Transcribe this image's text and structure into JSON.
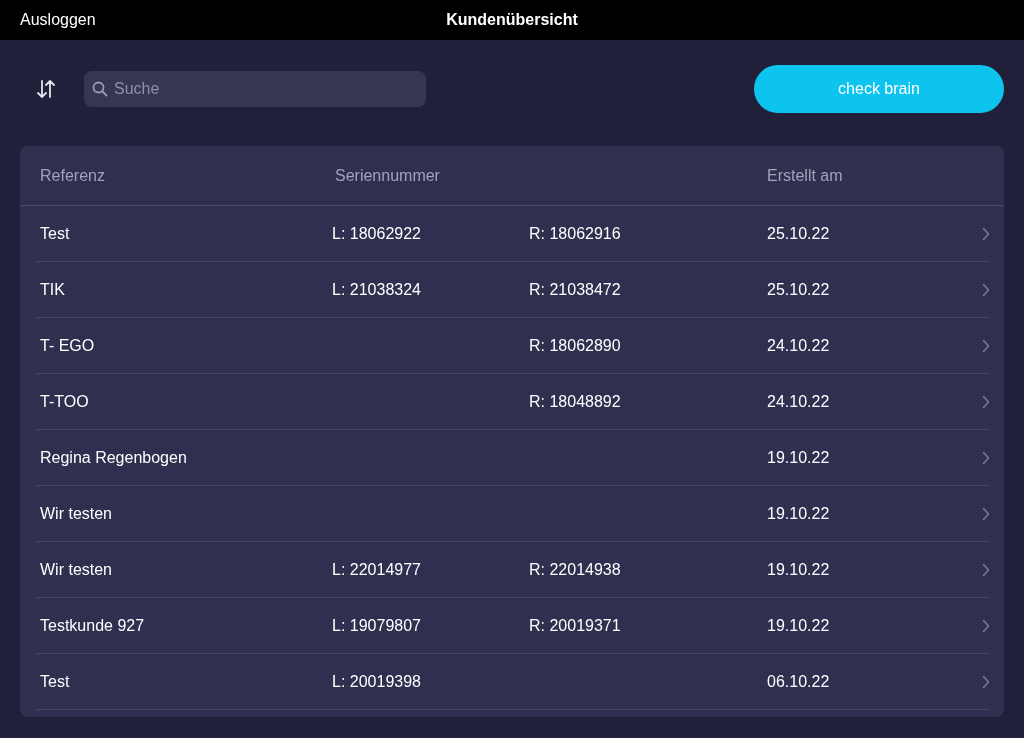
{
  "top_bar": {
    "logout": "Ausloggen",
    "title": "Kundenübersicht"
  },
  "toolbar": {
    "search": {
      "placeholder": "Suche"
    },
    "button": "check brain"
  },
  "table": {
    "columns": [
      "Referenz",
      "Seriennummer",
      "Erstellt am"
    ],
    "rows": [
      {
        "reference": "Test",
        "serial_left": "L: 18062922",
        "serial_right": "R: 18062916",
        "created": "25.10.22"
      },
      {
        "reference": "TIK",
        "serial_left": "L: 21038324",
        "serial_right": "R: 21038472",
        "created": "25.10.22"
      },
      {
        "reference": "T- EGO",
        "serial_right": "R: 18062890",
        "created": "24.10.22"
      },
      {
        "reference": "T-TOO",
        "serial_right": "R: 18048892",
        "created": "24.10.22"
      },
      {
        "reference": "Regina Regenbogen",
        "created": "19.10.22"
      },
      {
        "reference": "Wir testen",
        "created": "19.10.22"
      },
      {
        "reference": "Wir testen",
        "serial_left": "L: 22014977",
        "serial_right": "R: 22014938",
        "created": "19.10.22"
      },
      {
        "reference": "Testkunde 927",
        "serial_left": "L: 19079807",
        "serial_right": "R: 20019371",
        "created": "19.10.22"
      },
      {
        "reference": "Test",
        "serial_left": "L: 20019398",
        "created": "06.10.22"
      }
    ]
  }
}
